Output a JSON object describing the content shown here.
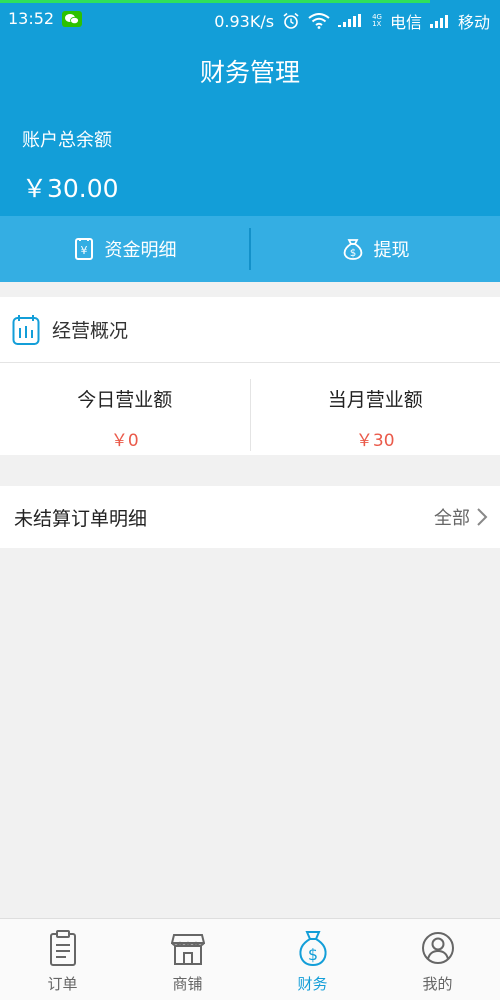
{
  "status_bar": {
    "time": "13:52",
    "speed": "0.93K/s",
    "net_top": "4G",
    "net_bottom": "1X",
    "carrier1": "电信",
    "carrier2": "移动"
  },
  "header": {
    "title": "财务管理",
    "balance_label": "账户总余额",
    "balance_value": "￥30.00"
  },
  "actions": {
    "details_label": "资金明细",
    "withdraw_label": "提现"
  },
  "overview": {
    "title": "经营概况",
    "today_label": "今日营业额",
    "today_value": "￥0",
    "month_label": "当月营业额",
    "month_value": "￥30"
  },
  "orders": {
    "title": "未结算订单明细",
    "all_label": "全部"
  },
  "tabbar": {
    "items": [
      {
        "label": "订单",
        "icon": "clipboard-icon"
      },
      {
        "label": "商铺",
        "icon": "shop-icon"
      },
      {
        "label": "财务",
        "icon": "money-bag-icon"
      },
      {
        "label": "我的",
        "icon": "user-icon"
      }
    ],
    "active_index": 2
  },
  "colors": {
    "primary": "#139ed8",
    "action_bar": "#34aee3",
    "accent_red": "#ea5a4a",
    "background": "#f1f1f1"
  }
}
